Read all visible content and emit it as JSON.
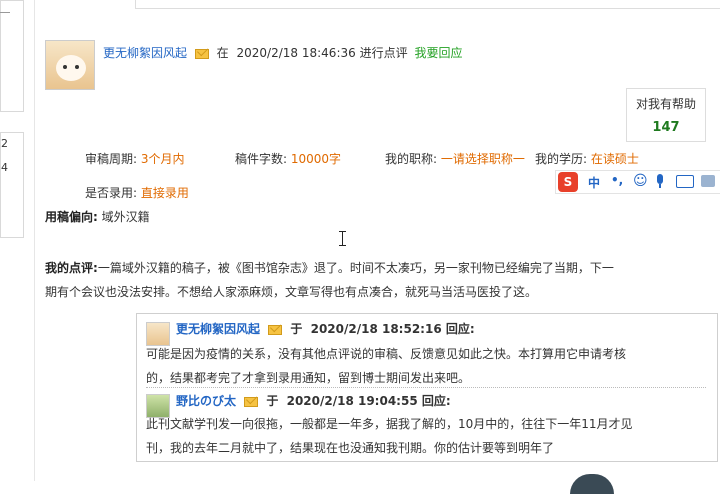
{
  "main_comment": {
    "author": "更无柳絮因风起",
    "at_word": "在",
    "timestamp": "2020/2/18 18:46:36",
    "action": "进行点评",
    "reply_link": "我要回应",
    "helpful_label": "对我有帮助",
    "helpful_count": "147",
    "review_period_label": "审稿周期:",
    "review_period_value": "3个月内",
    "word_count_label": "稿件字数:",
    "word_count_value": "10000字",
    "title_label": "我的职称:",
    "title_value": "一请选择职称一",
    "degree_label": "我的学历:",
    "degree_value": "在读硕士",
    "accepted_label": "是否录用:",
    "accepted_value": "直接录用",
    "preference_label": "用稿偏向:",
    "preference_value": "域外汉籍",
    "review_label": "我的点评:",
    "review_line1": "一篇域外汉籍的稿子，被《图书馆杂志》退了。时间不太凑巧，另一家刊物已经编完了当期，下一",
    "review_line2": "期有个会议也没法安排。不想给人家添麻烦，文章写得也有点凑合，就死马当活马医投了这。"
  },
  "replies": [
    {
      "author": "更无柳絮因风起",
      "at_word": "于",
      "timestamp": "2020/2/18 18:52:16",
      "suffix": "回应:",
      "line1": "可能是因为疫情的关系，没有其他点评说的审稿、反馈意见如此之快。本打算用它申请考核",
      "line2": "的，结果都考完了才拿到录用通知，留到博士期间发出来吧。"
    },
    {
      "author": "野比のび太",
      "at_word": "于",
      "timestamp": "2020/2/18 19:04:55",
      "suffix": "回应:",
      "line1": "此刊文献学刊发一向很拖，一般都是一年多，据我了解的，10月中的，往往下一年11月才见",
      "line2": "刊，我的去年二月就中了，结果现在也没通知我刊期。你的估计要等到明年了"
    }
  ],
  "sidebar": {
    "box2_line1": "2",
    "box2_line2": "4"
  },
  "ime_toolbar": {
    "logo": "S",
    "mode": "中",
    "punct": "•,",
    "emoji": "☺",
    "mic": "🎤",
    "keyboard": "⌨",
    "skin": "👕",
    "user": "👤"
  },
  "colors": {
    "author_blue": "#2366c4",
    "value_orange": "#e06a00",
    "reply_green": "#23a123",
    "helpful_green": "#1f7a1f",
    "ime_red": "#e8402a"
  }
}
